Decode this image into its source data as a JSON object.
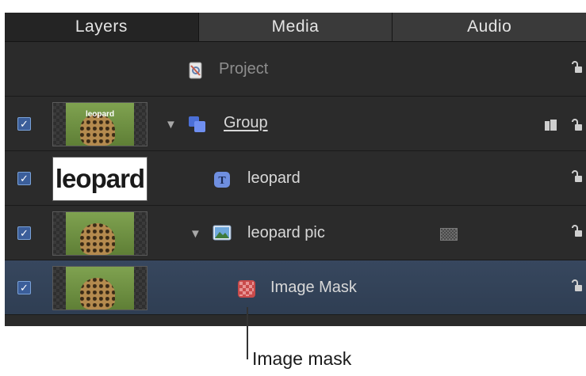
{
  "tabs": [
    "Layers",
    "Media",
    "Audio"
  ],
  "rows": {
    "project": {
      "label": "Project"
    },
    "group": {
      "label": "Group",
      "checked": true
    },
    "leopard_text": {
      "label": "leopard",
      "thumb_text": "leopard",
      "checked": true
    },
    "leopard_pic": {
      "label": "leopard pic",
      "checked": true
    },
    "image_mask": {
      "label": "Image Mask",
      "checked": true
    }
  },
  "group_thumb_text": "leopard",
  "callout": {
    "label": "Image mask"
  },
  "colors": {
    "selected_row": "#37475e",
    "checkbox": "#3b5e9a",
    "panel_bg": "#2b2b2b"
  }
}
